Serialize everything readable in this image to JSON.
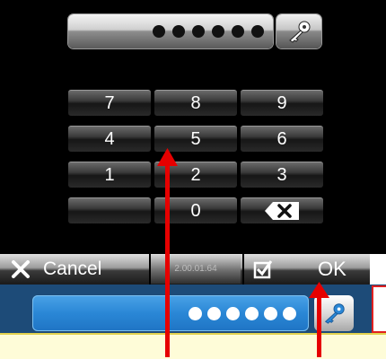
{
  "password_field": {
    "masked_value": "●●●●●●",
    "dot_count": 6
  },
  "keypad": {
    "keys": [
      "7",
      "8",
      "9",
      "4",
      "5",
      "6",
      "1",
      "2",
      "3",
      "",
      "0",
      "⌫"
    ]
  },
  "bottom_bar": {
    "cancel_label": "Cancel",
    "version": "2.00.01.64",
    "ok_label": "OK"
  },
  "lower_field": {
    "masked_value": "●●●●●●"
  },
  "icons": {
    "key": "key-icon",
    "backspace": "backspace-icon",
    "close": "close-icon",
    "checkbox": "checkbox-checked-icon",
    "arrow": "red-arrow-icon"
  },
  "colors": {
    "annotation": "#e60000",
    "lower_field": "#2a87d6",
    "strip": "#1d4b78"
  }
}
